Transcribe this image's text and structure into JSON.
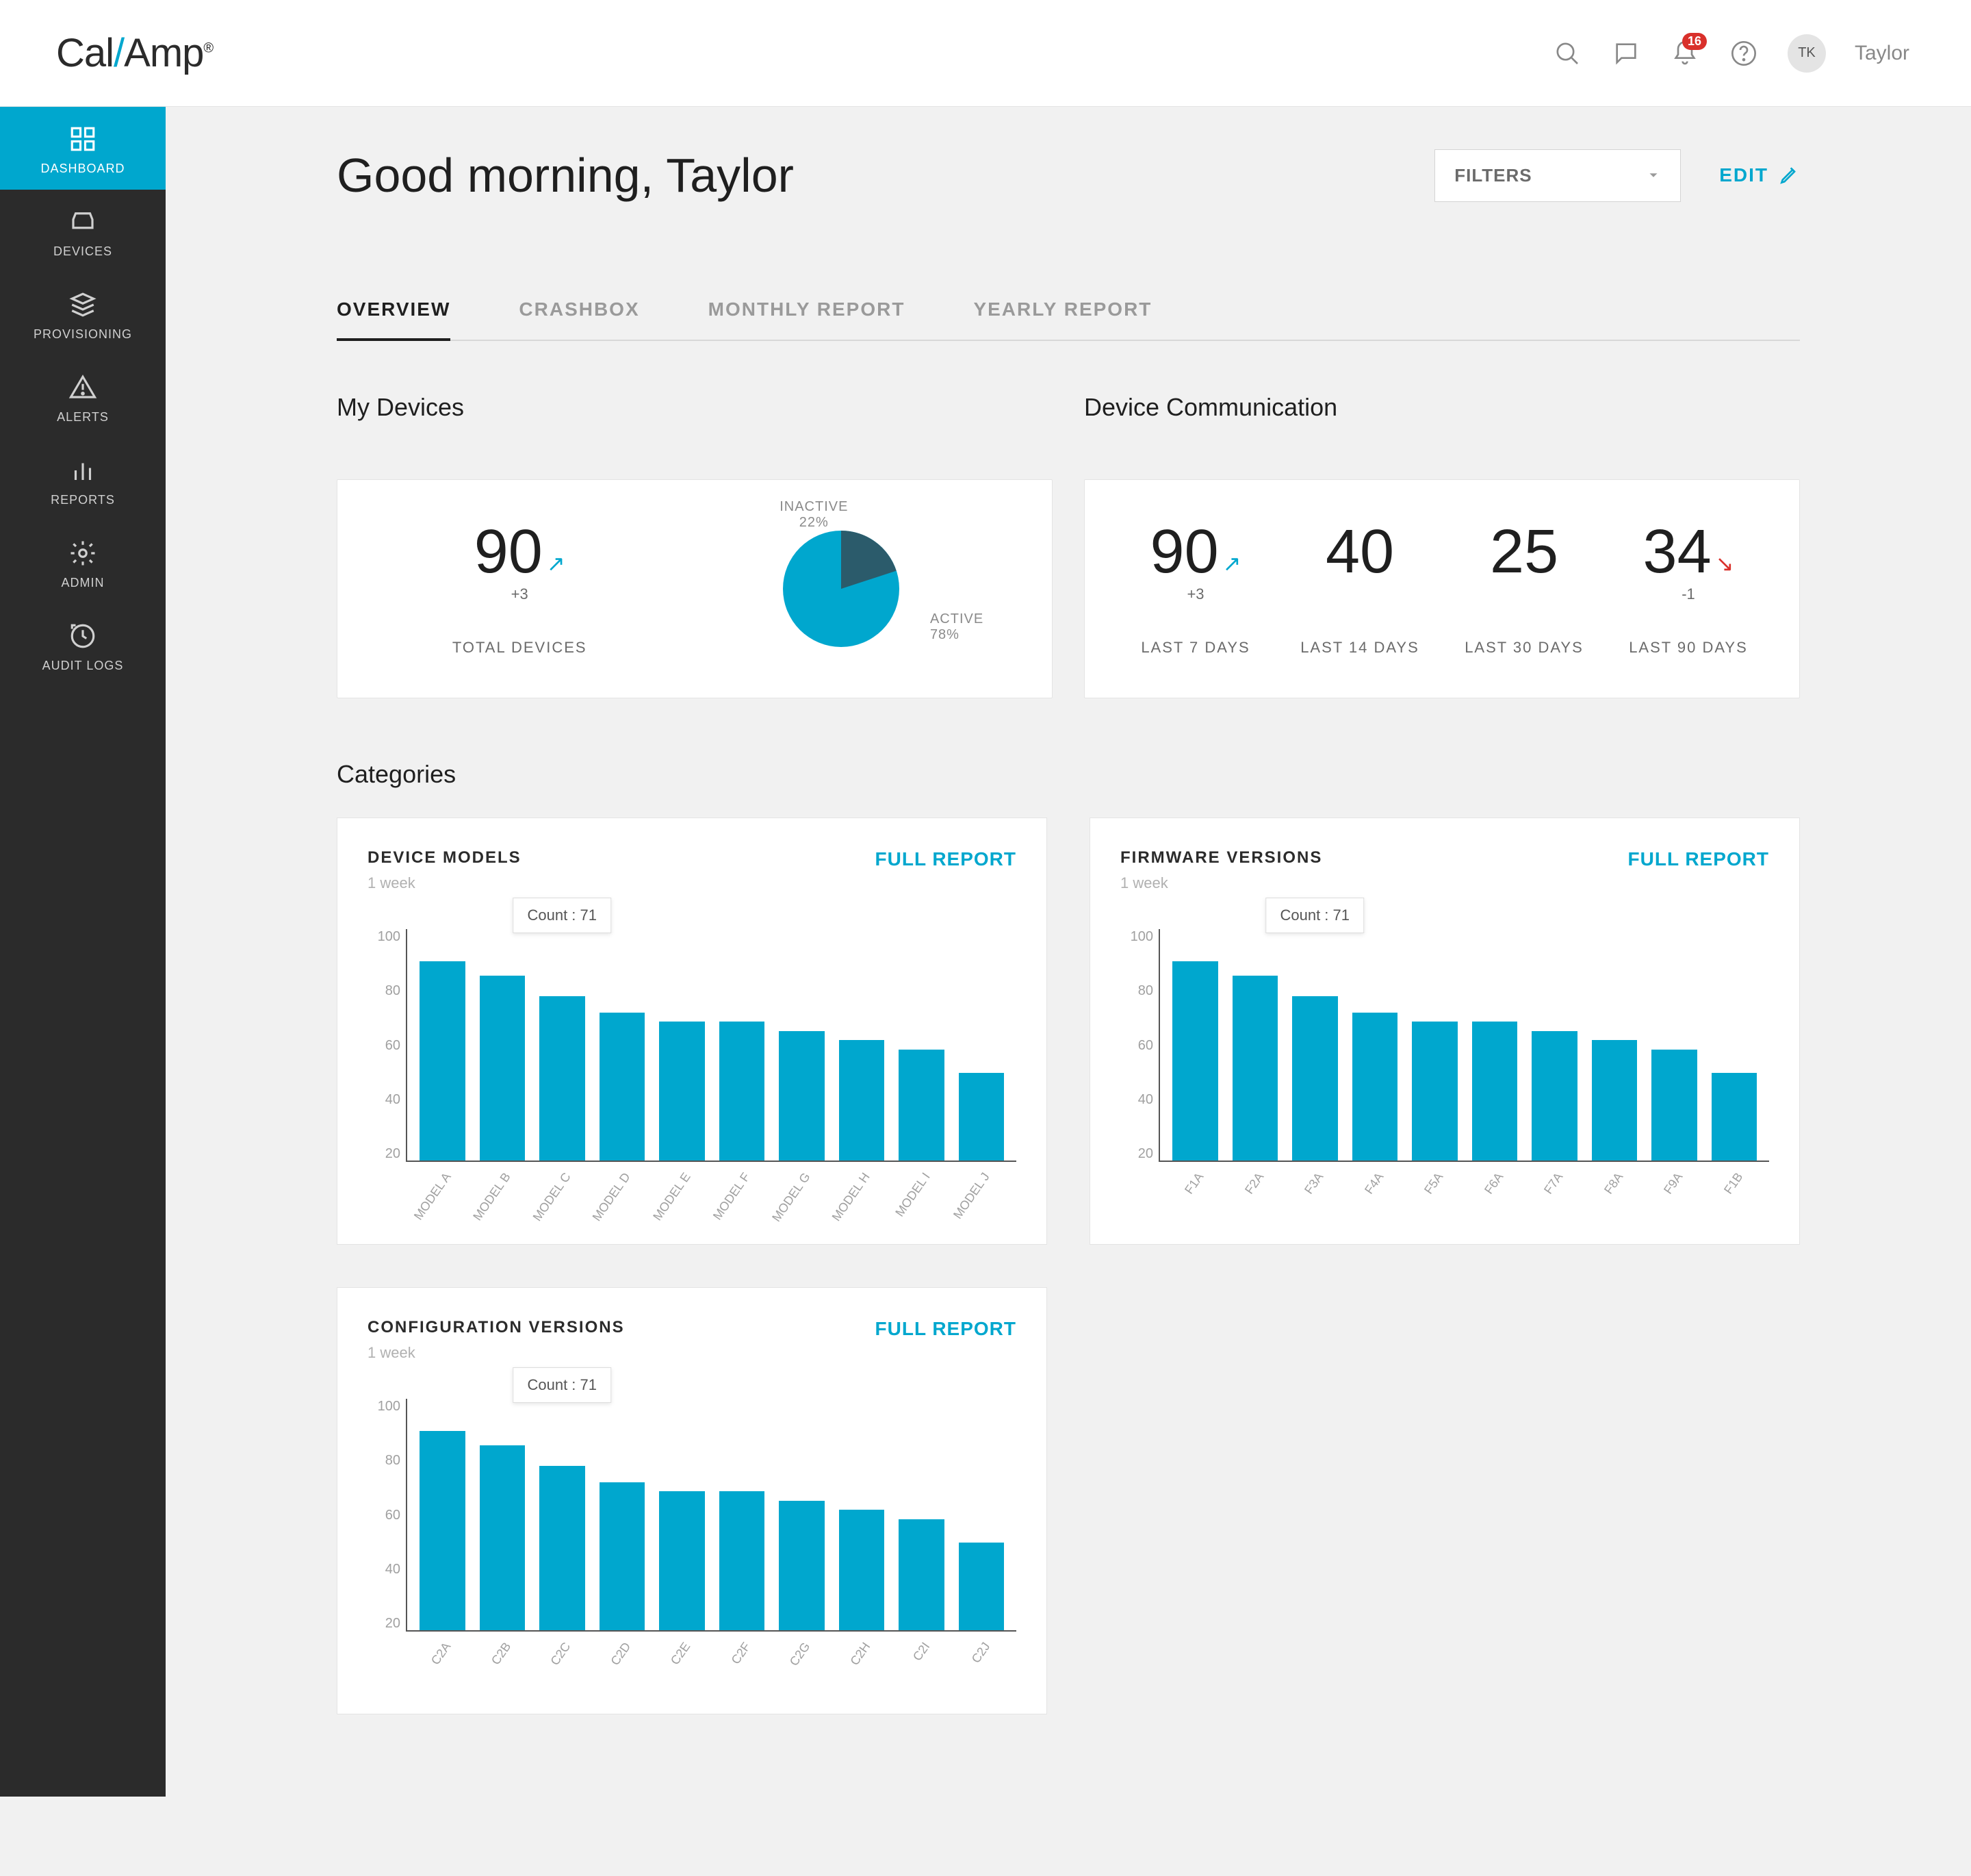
{
  "brand": {
    "part1": "Cal",
    "slash": "/",
    "part2": "Amp",
    "reg": "®"
  },
  "topbar": {
    "notification_count": "16",
    "user_initials": "TK",
    "user_name": "Taylor"
  },
  "sidebar": {
    "items": [
      {
        "label": "DASHBOARD",
        "active": true
      },
      {
        "label": "DEVICES"
      },
      {
        "label": "PROVISIONING"
      },
      {
        "label": "ALERTS"
      },
      {
        "label": "REPORTS"
      },
      {
        "label": "ADMIN"
      },
      {
        "label": "AUDIT LOGS"
      }
    ]
  },
  "header": {
    "greeting": "Good morning, Taylor",
    "filters_label": "FILTERS",
    "edit_label": "EDIT"
  },
  "tabs": [
    {
      "label": "OVERVIEW",
      "active": true
    },
    {
      "label": "CRASHBOX"
    },
    {
      "label": "MONTHLY REPORT"
    },
    {
      "label": "YEARLY REPORT"
    }
  ],
  "sections": {
    "my_devices_title": "My Devices",
    "device_comm_title": "Device Communication",
    "categories_title": "Categories"
  },
  "my_devices": {
    "total": "90",
    "delta": "+3",
    "caption": "TOTAL DEVICES",
    "pie": {
      "inactive_label": "INACTIVE",
      "inactive_pct": "22%",
      "active_label": "ACTIVE",
      "active_pct": "78%"
    }
  },
  "comm": [
    {
      "value": "90",
      "delta": "+3",
      "trend": "up",
      "caption": "LAST 7 DAYS"
    },
    {
      "value": "40",
      "delta": "",
      "trend": "",
      "caption": "LAST 14 DAYS"
    },
    {
      "value": "25",
      "delta": "",
      "trend": "",
      "caption": "LAST 30 DAYS"
    },
    {
      "value": "34",
      "delta": "-1",
      "trend": "down",
      "caption": "LAST 90 DAYS"
    }
  ],
  "charts": {
    "full_report_label": "FULL REPORT",
    "tooltip_prefix": "Count : ",
    "device_models": {
      "title": "DEVICE MODELS",
      "subtitle": "1 week",
      "tooltip_value": "71"
    },
    "firmware": {
      "title": "FIRMWARE VERSIONS",
      "subtitle": "1 week",
      "tooltip_value": "71"
    },
    "config": {
      "title": "CONFIGURATION VERSIONS",
      "subtitle": "1 week",
      "tooltip_value": "71"
    }
  },
  "chart_data": [
    {
      "id": "device_models",
      "type": "bar",
      "title": "DEVICE MODELS",
      "ylim": [
        0,
        100
      ],
      "yticks": [
        20,
        40,
        60,
        80,
        100
      ],
      "categories": [
        "MODEL A",
        "MODEL B",
        "MODEL C",
        "MODEL D",
        "MODEL E",
        "MODEL F",
        "MODEL G",
        "MODEL H",
        "MODEL I",
        "MODEL J"
      ],
      "values": [
        86,
        80,
        71,
        64,
        60,
        60,
        56,
        52,
        48,
        38
      ],
      "tooltip_index": 2
    },
    {
      "id": "firmware",
      "type": "bar",
      "title": "FIRMWARE VERSIONS",
      "ylim": [
        0,
        100
      ],
      "yticks": [
        20,
        40,
        60,
        80,
        100
      ],
      "categories": [
        "F1A",
        "F2A",
        "F3A",
        "F4A",
        "F5A",
        "F6A",
        "F7A",
        "F8A",
        "F9A",
        "F1B"
      ],
      "values": [
        86,
        80,
        71,
        64,
        60,
        60,
        56,
        52,
        48,
        38
      ],
      "tooltip_index": 2
    },
    {
      "id": "config",
      "type": "bar",
      "title": "CONFIGURATION VERSIONS",
      "ylim": [
        0,
        100
      ],
      "yticks": [
        20,
        40,
        60,
        80,
        100
      ],
      "categories": [
        "C2A",
        "C2B",
        "C2C",
        "C2D",
        "C2E",
        "C2F",
        "C2G",
        "C2H",
        "C2I",
        "C2J"
      ],
      "values": [
        86,
        80,
        71,
        64,
        60,
        60,
        56,
        52,
        48,
        38
      ],
      "tooltip_index": 2
    }
  ]
}
